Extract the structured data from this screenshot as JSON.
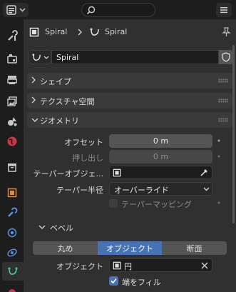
{
  "header": {
    "search_placeholder": ""
  },
  "breadcrumb": {
    "object": "Spiral",
    "data": "Spiral"
  },
  "datablock": {
    "name": "Spiral"
  },
  "panels": {
    "shape": "シェイプ",
    "texture_space": "テクスチャ空間",
    "geometry": "ジオメトリ"
  },
  "geometry": {
    "offset_label": "オフセット",
    "offset_value": "0 m",
    "extrude_label": "押し出し",
    "extrude_value": "0 m",
    "taper_object_label": "テーパーオブジェ...",
    "taper_radius_label": "テーパー半径",
    "taper_radius_value": "オーバーライド",
    "taper_mapping_label": "テーパーマッピング"
  },
  "bevel": {
    "title": "ベベル",
    "modes": [
      "丸め",
      "オブジェクト",
      "断面"
    ],
    "active_mode": 1,
    "object_label": "オブジェクト",
    "object_value": "円",
    "fill_caps_label": "端をフィル",
    "fill_caps_checked": true
  },
  "colors": {
    "accent": "#4772b3",
    "panel_bg": "#303030",
    "field_bg": "#545454"
  }
}
